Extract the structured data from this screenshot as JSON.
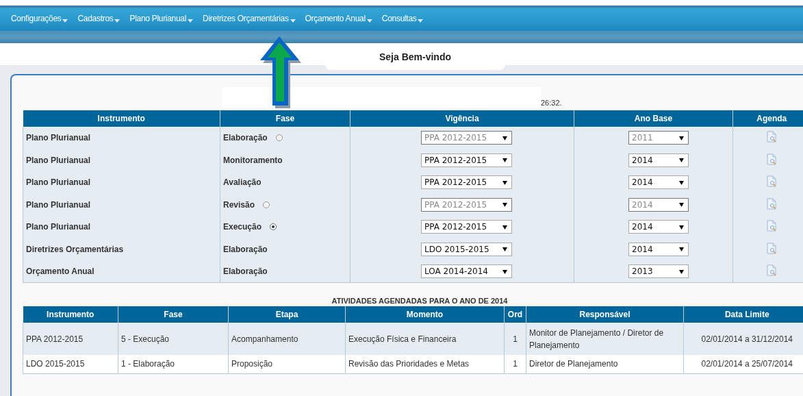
{
  "menu": [
    {
      "label": "Configurações"
    },
    {
      "label": "Cadastros"
    },
    {
      "label": "Plano Plurianual"
    },
    {
      "label": "Diretrizes Orçamentárias"
    },
    {
      "label": "Orçamento Anual"
    },
    {
      "label": "Consultas"
    }
  ],
  "welcome": "Seja Bem-vindo",
  "timestamp": "26:32.",
  "plans": {
    "columns": [
      "Instrumento",
      "Fase",
      "Vigência",
      "Ano Base",
      "Agenda"
    ],
    "rows": [
      {
        "instrument": "Plano Plurianual",
        "phase": "Elaboração",
        "radio": {
          "selected": false
        },
        "term": {
          "value": "PPA 2012-2015",
          "disabled": true
        },
        "base_year": {
          "value": "2011",
          "disabled": true
        }
      },
      {
        "instrument": "Plano Plurianual",
        "phase": "Monitoramento",
        "term": {
          "value": "PPA 2012-2015",
          "disabled": false
        },
        "base_year": {
          "value": "2014",
          "disabled": false
        }
      },
      {
        "instrument": "Plano Plurianual",
        "phase": "Avaliação",
        "term": {
          "value": "PPA 2012-2015",
          "disabled": false
        },
        "base_year": {
          "value": "2014",
          "disabled": false
        }
      },
      {
        "instrument": "Plano Plurianual",
        "phase": "Revisão",
        "radio": {
          "selected": false
        },
        "term": {
          "value": "PPA 2012-2015",
          "disabled": true
        },
        "base_year": {
          "value": "2014",
          "disabled": true
        }
      },
      {
        "instrument": "Plano Plurianual",
        "phase": "Execução",
        "radio": {
          "selected": true
        },
        "term": {
          "value": "PPA 2012-2015",
          "disabled": false
        },
        "base_year": {
          "value": "2014",
          "disabled": false
        }
      },
      {
        "instrument": "Diretrizes Orçamentárias",
        "phase": "Elaboração",
        "term": {
          "value": "LDO 2015-2015",
          "disabled": false
        },
        "base_year": {
          "value": "2014",
          "disabled": false
        }
      },
      {
        "instrument": "Orçamento Anual",
        "phase": "Elaboração",
        "term": {
          "value": "LOA 2014-2014",
          "disabled": false
        },
        "base_year": {
          "value": "2013",
          "disabled": false
        }
      }
    ]
  },
  "activities": {
    "title": "ATIVIDADES AGENDADAS PARA O ANO DE 2014",
    "columns": [
      "Instrumento",
      "Fase",
      "Etapa",
      "Momento",
      "Ord",
      "Responsável",
      "Data Limite"
    ],
    "rows": [
      [
        "PPA 2012-2015",
        "5 - Execução",
        "Acompanhamento",
        "Execução Física e Financeira",
        "1",
        "Monitor de Planejamento / Diretor de Planejamento",
        "02/01/2014 a 31/12/2014"
      ],
      [
        "LDO 2015-2015",
        "1 - Elaboração",
        "Proposição",
        "Revisão das Prioridades e Metas",
        "1",
        "Diretor de Planejamento",
        "02/01/2014 a 25/07/2014"
      ]
    ]
  }
}
